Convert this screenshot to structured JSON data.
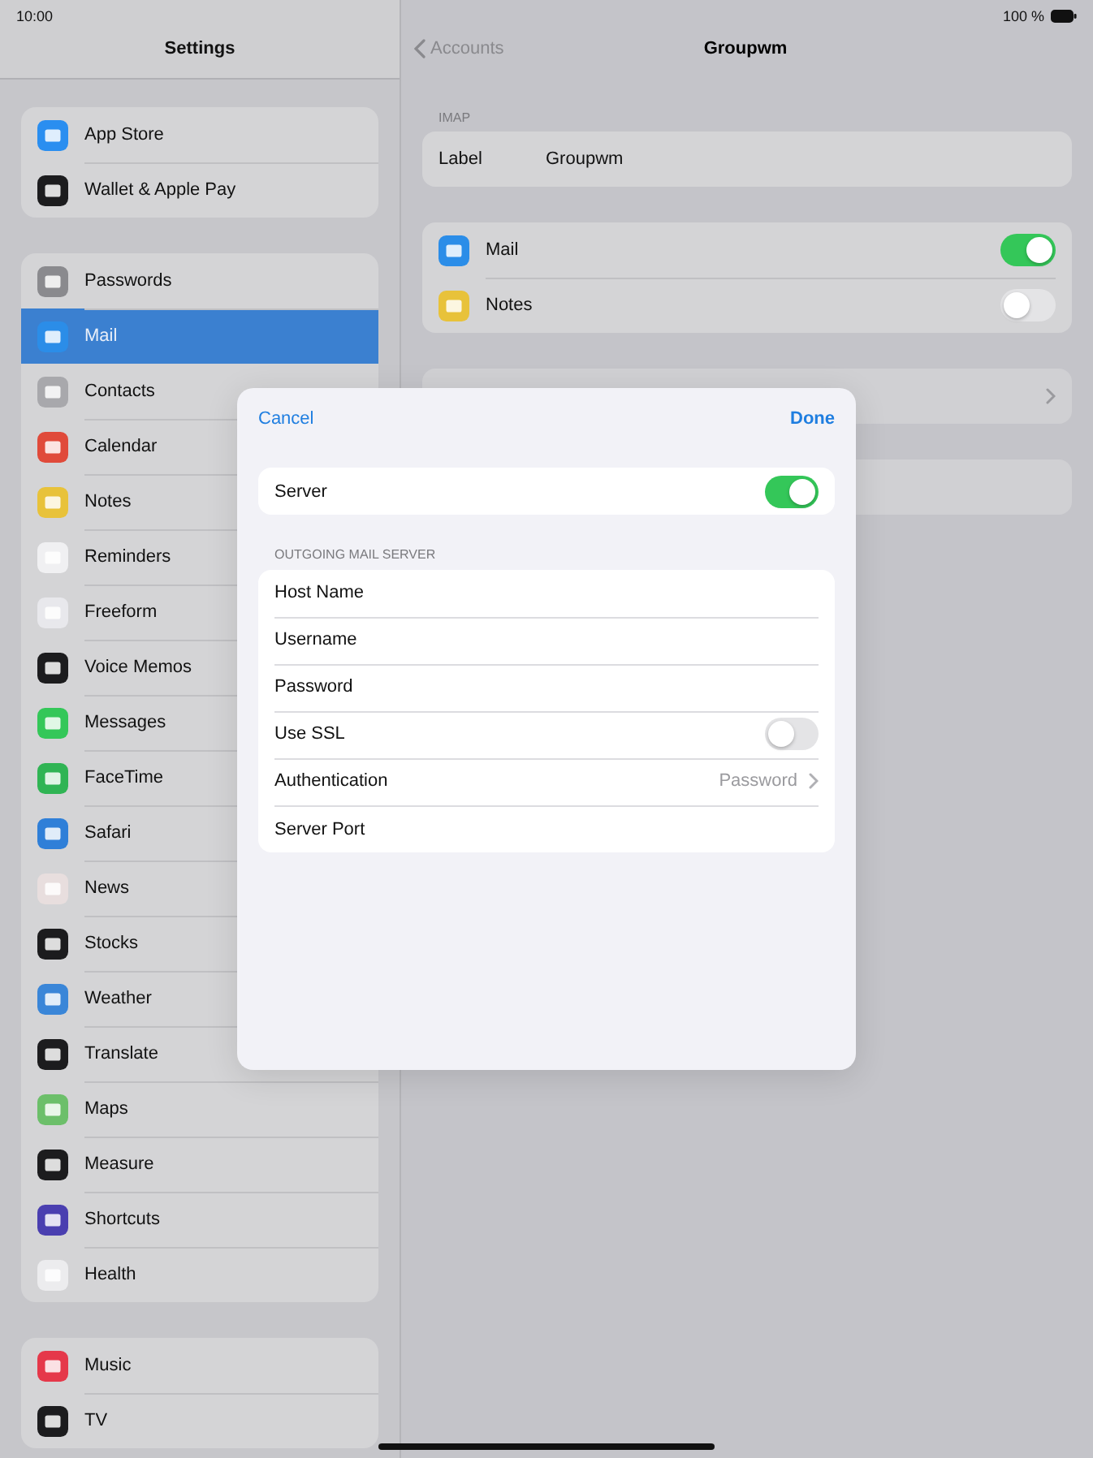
{
  "status_bar": {
    "time": "10:00",
    "battery": "100 %"
  },
  "sidebar": {
    "title": "Settings",
    "groups": [
      {
        "items": [
          {
            "label": "App Store",
            "color": "#2a8ef0",
            "selected": false
          },
          {
            "label": "Wallet & Apple Pay",
            "color": "#1c1c1e",
            "selected": false
          }
        ]
      },
      {
        "items": [
          {
            "label": "Passwords",
            "color": "#8a8a8e",
            "selected": false
          },
          {
            "label": "Mail",
            "color": "#2b8de8",
            "selected": true
          },
          {
            "label": "Contacts",
            "color": "#a8a8ac",
            "selected": false
          },
          {
            "label": "Calendar",
            "color": "#e04a3a",
            "selected": false
          },
          {
            "label": "Notes",
            "color": "#e8c23a",
            "selected": false
          },
          {
            "label": "Reminders",
            "color": "#f0f0f2",
            "selected": false
          },
          {
            "label": "Freeform",
            "color": "#e8e8ec",
            "selected": false
          },
          {
            "label": "Voice Memos",
            "color": "#1c1c1e",
            "selected": false
          },
          {
            "label": "Messages",
            "color": "#34c759",
            "selected": false
          },
          {
            "label": "FaceTime",
            "color": "#30b454",
            "selected": false
          },
          {
            "label": "Safari",
            "color": "#2f7fd8",
            "selected": false
          },
          {
            "label": "News",
            "color": "#e8dede",
            "selected": false
          },
          {
            "label": "Stocks",
            "color": "#1c1c1e",
            "selected": false
          },
          {
            "label": "Weather",
            "color": "#3a86d8",
            "selected": false
          },
          {
            "label": "Translate",
            "color": "#1c1c1e",
            "selected": false
          },
          {
            "label": "Maps",
            "color": "#6cbf6a",
            "selected": false
          },
          {
            "label": "Measure",
            "color": "#1c1c1e",
            "selected": false
          },
          {
            "label": "Shortcuts",
            "color": "#4a3fb0",
            "selected": false
          },
          {
            "label": "Health",
            "color": "#ececee",
            "selected": false
          }
        ]
      },
      {
        "items": [
          {
            "label": "Music",
            "color": "#e5384a",
            "selected": false
          },
          {
            "label": "TV",
            "color": "#1c1c1e",
            "selected": false
          }
        ]
      }
    ]
  },
  "detail": {
    "back": "Accounts",
    "title": "Groupwm",
    "section_label": "IMAP",
    "label_row": {
      "label": "Label",
      "value": "Groupwm"
    },
    "apps": [
      {
        "label": "Mail",
        "color": "#2b8de8",
        "on": true
      },
      {
        "label": "Notes",
        "color": "#e8c23a",
        "on": false
      }
    ]
  },
  "dialog": {
    "cancel": "Cancel",
    "done": "Done",
    "server": {
      "label": "Server",
      "on": true
    },
    "section_label": "OUTGOING MAIL SERVER",
    "rows": [
      {
        "kind": "field",
        "label": "Host Name"
      },
      {
        "kind": "field",
        "label": "Username"
      },
      {
        "kind": "field",
        "label": "Password"
      },
      {
        "kind": "toggle",
        "label": "Use SSL",
        "on": false
      },
      {
        "kind": "detail",
        "label": "Authentication",
        "value": "Password"
      },
      {
        "kind": "field",
        "label": "Server Port"
      }
    ]
  }
}
